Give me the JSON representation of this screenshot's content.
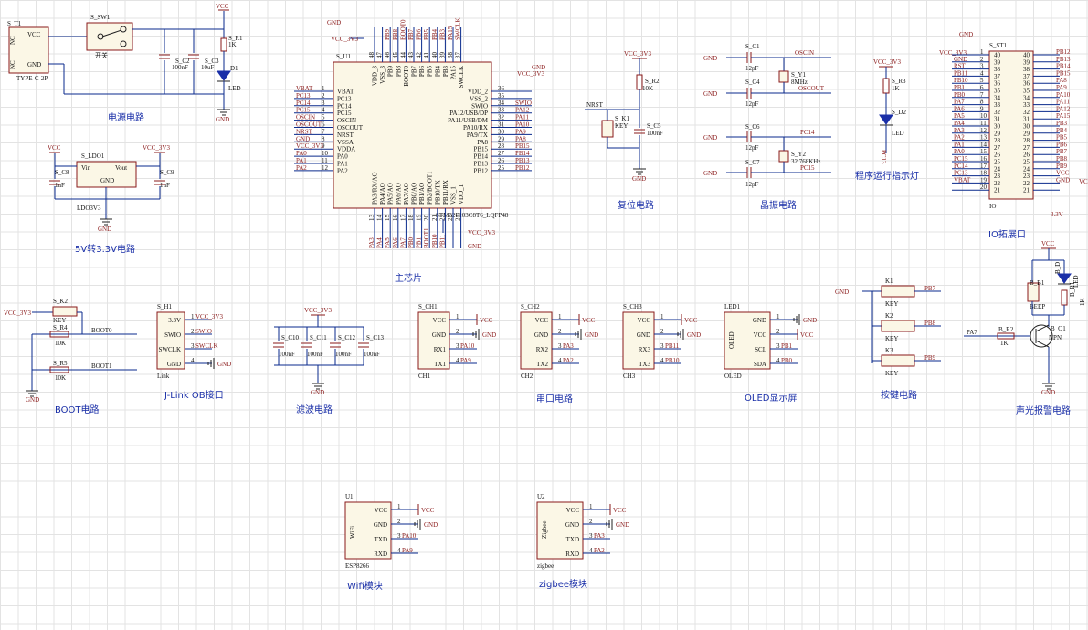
{
  "colors": {
    "wire": "#0a2a8c",
    "component": "#8a1a1a",
    "title": "#1a2fa8",
    "grid": "#e3e3e3"
  },
  "titles": {
    "power": "电源电路",
    "ldo": "5V转3.3V电路",
    "mcu": "主芯片",
    "reset": "复位电路",
    "crystal": "晶振电路",
    "led": "程序运行指示灯",
    "io": "IO拓展口",
    "boot": "BOOT电路",
    "jlink": "J-Link OB接口",
    "filter": "滤波电路",
    "uart": "串口电路",
    "oled": "OLED显示屏",
    "keys": "按键电路",
    "alarm": "声光报警电路",
    "wifi": "Wifi模块",
    "zigbee": "zigbee模块"
  },
  "power": {
    "ref": "S_T1",
    "part": "TYPE-C-2P",
    "pin_vcc": "VCC",
    "pin_gnd": "GND",
    "nc": "NC",
    "sw_ref": "S_SW1",
    "sw_name": "开关",
    "c2": "S_C2",
    "c2v": "100nF",
    "c3": "S_C3",
    "c3v": "10uF",
    "r1": "S_R1",
    "r1v": "1K",
    "d1": "D1",
    "d1v": "LED",
    "vcc": "VCC",
    "gnd": "GND"
  },
  "ldo": {
    "ref": "S_LDO1",
    "part": "LDO3V3",
    "vin": "Vin",
    "vout": "Vout",
    "gnd": "GND",
    "c8": "S_C8",
    "c8v": "1uF",
    "c9": "S_C9",
    "c9v": "1uF",
    "vcc": "VCC",
    "v33": "VCC_3V3"
  },
  "mcu": {
    "ref": "S_U1",
    "part": "STM32F103C8T6_LQFP48",
    "left": [
      [
        "VBAT",
        "1"
      ],
      [
        "PC13",
        "2"
      ],
      [
        "PC14",
        "3"
      ],
      [
        "PC15",
        "4"
      ],
      [
        "OSCIN",
        "5"
      ],
      [
        "OSCOUT",
        "6"
      ],
      [
        "NRST",
        "7"
      ],
      [
        "VSSA",
        "8"
      ],
      [
        "VDDA",
        "9"
      ],
      [
        "PA0",
        "10"
      ],
      [
        "PA1",
        "11"
      ],
      [
        "PA2",
        "12"
      ]
    ],
    "right": [
      [
        "VDD_2",
        "36"
      ],
      [
        "VSS_2",
        "35"
      ],
      [
        "SWIO",
        "34"
      ],
      [
        "PA12/USB/DP",
        "33"
      ],
      [
        "PA11/USB/DM",
        "32"
      ],
      [
        "PA10/RX",
        "31"
      ],
      [
        "PA9/TX",
        "30"
      ],
      [
        "PA8",
        "29"
      ],
      [
        "PB15",
        "28"
      ],
      [
        "PB14",
        "27"
      ],
      [
        "PB13",
        "26"
      ],
      [
        "PB12",
        "25"
      ]
    ],
    "right_nets": [
      "",
      "",
      "SWIO",
      "PA12",
      "PA11",
      "PA10",
      "PA9",
      "PA8",
      "PB15",
      "PB14",
      "PB13",
      "PB12"
    ],
    "left_nets": [
      "VBAT",
      "PC13",
      "PC14",
      "PC15",
      "OSCIN",
      "OSCOUT",
      "NRST",
      "GND",
      "VCC_3V3",
      "PA0",
      "PA1",
      "PA2"
    ],
    "top": [
      "VDD_3",
      "VSS_3",
      "PB9",
      "PB8",
      "BOOT0",
      "PB7",
      "PB6",
      "PB5",
      "PB4",
      "PB3",
      "PA15",
      "SWCLK"
    ],
    "top_nums": [
      "48",
      "47",
      "46",
      "45",
      "44",
      "43",
      "42",
      "41",
      "40",
      "39",
      "38",
      "37"
    ],
    "top_nets": [
      "",
      "",
      "PB9",
      "PB8",
      "BOOT0",
      "PB7",
      "PB6",
      "PB5",
      "PB4",
      "PB3",
      "PA15",
      "SWCLK"
    ],
    "bottom": [
      "PA3/RX/AO",
      "PA4/AO",
      "PA5/AO",
      "PA6/AO",
      "PA7/AO",
      "PB0/AO",
      "PB1/AO",
      "PB2/BOOT1",
      "PB10/TX",
      "PB11/RX",
      "VSS_1",
      "VDD_1"
    ],
    "bottom_nums": [
      "13",
      "14",
      "15",
      "16",
      "17",
      "18",
      "19",
      "20",
      "21",
      "22",
      "23",
      "24"
    ],
    "bottom_nets": [
      "PA3",
      "PA4",
      "PA5",
      "PA6",
      "PA7",
      "PB0",
      "PB1",
      "BOOT1",
      "PB10",
      "PB11",
      "",
      ""
    ],
    "gnd": "GND",
    "v33": "VCC_3V3"
  },
  "reset": {
    "net": "VCC_3V3",
    "r2": "S_R2",
    "r2v": "10K",
    "k1": "S_K1",
    "k1v": "KEY",
    "c5": "S_C5",
    "c5v": "100nF",
    "nrst": "NRST",
    "gnd": "GND"
  },
  "crystal": {
    "c1": "S_C1",
    "c4": "S_C4",
    "c6": "S_C6",
    "c7": "S_C7",
    "cv": "12pF",
    "y1": "S_Y1",
    "y1v": "8MHz",
    "y2": "S_Y2",
    "y2v": "32.768KHz",
    "oscin": "OSCIN",
    "oscout": "OSCOUT",
    "pc14": "PC14",
    "pc15": "PC15",
    "gnd": "GND"
  },
  "led": {
    "net": "VCC_3V3",
    "r3": "S_R3",
    "r3v": "1K",
    "d2": "S_D2",
    "d2v": "LED",
    "pc13": "PC13"
  },
  "io": {
    "ref": "S_ST1",
    "part": "IO",
    "v33": "VCC_3V3",
    "gnd": "GND",
    "vcc": "VCC",
    "v33b": "3.3V",
    "left": [
      "GND",
      "RST",
      "PB11",
      "PB10",
      "PB1",
      "PB0",
      "PA7",
      "PA6",
      "PA5",
      "PA4",
      "PA3",
      "PA2",
      "PA1",
      "PA0",
      "PC15",
      "PC14",
      "PC13",
      "VBAT"
    ],
    "right": [
      "PB12",
      "PB13",
      "PB14",
      "PB15",
      "PA8",
      "PA9",
      "PA10",
      "PA11",
      "PA12",
      "PA15",
      "PB3",
      "PB4",
      "PB5",
      "PB6",
      "PB7",
      "PB8",
      "PB9",
      "VCC",
      "GND"
    ]
  },
  "boot": {
    "net": "VCC_3V3",
    "k2": "S_K2",
    "k2v": "KEY",
    "r4": "S_R4",
    "r4v": "10K",
    "r5": "S_R5",
    "r5v": "10K",
    "boot0": "BOOT0",
    "boot1": "BOOT1",
    "gnd": "GND"
  },
  "jlink": {
    "ref": "S_H1",
    "part": "Link",
    "pins": [
      "3.3V",
      "SWIO",
      "SWCLK",
      "GND"
    ],
    "nets": [
      "VCC_3V3",
      "SWIO",
      "SWCLK",
      "GND"
    ]
  },
  "filter": {
    "net": "VCC_3V3",
    "caps": [
      "S_C10",
      "S_C11",
      "S_C12",
      "S_C13"
    ],
    "cv": "100nF",
    "gnd": "GND"
  },
  "uart": [
    {
      "ref": "S_CH1",
      "part": "CH1",
      "pins": [
        "VCC",
        "GND",
        "RX1",
        "TX1"
      ],
      "nets": [
        "VCC",
        "GND",
        "PA10",
        "PA9"
      ]
    },
    {
      "ref": "S_CH2",
      "part": "CH2",
      "pins": [
        "VCC",
        "GND",
        "RX2",
        "TX2"
      ],
      "nets": [
        "VCC",
        "GND",
        "PA3",
        "PA2"
      ]
    },
    {
      "ref": "S_CH3",
      "part": "CH3",
      "pins": [
        "VCC",
        "GND",
        "RX3",
        "TX3"
      ],
      "nets": [
        "VCC",
        "GND",
        "PB11",
        "PB10"
      ]
    }
  ],
  "oled": {
    "ref": "LED1",
    "part": "OLED",
    "pins": [
      "GND",
      "VCC",
      "SCL",
      "SDA"
    ],
    "nets": [
      "GND",
      "VCC",
      "PB1",
      "PB0"
    ]
  },
  "keys": {
    "gnd": "GND",
    "items": [
      {
        "ref": "K1",
        "v": "KEY",
        "net": "PB7"
      },
      {
        "ref": "K2",
        "v": "KEY",
        "net": "PB8"
      },
      {
        "ref": "K3",
        "v": "KEY",
        "net": "PB9"
      }
    ]
  },
  "alarm": {
    "vcc": "VCC",
    "b1": "B_B1",
    "b1v": "BEEP",
    "d": "B_D",
    "dv": "LED",
    "r1": "B_R1",
    "r1v": "1K",
    "r2": "B_R2",
    "r2v": "1K",
    "q1": "B_Q1",
    "q1v": "NPN",
    "pa7": "PA7",
    "gnd": "GND"
  },
  "wifi": {
    "ref": "U1",
    "part": "ESP8266",
    "side": "WiFi",
    "pins": [
      "VCC",
      "GND",
      "TXD",
      "RXD"
    ],
    "nets": [
      "VCC",
      "GND",
      "PA10",
      "PA9"
    ]
  },
  "zigbee": {
    "ref": "U2",
    "part": "zigbee",
    "side": "Zigbee",
    "pins": [
      "VCC",
      "GND",
      "TXD",
      "RXD"
    ],
    "nets": [
      "VCC",
      "GND",
      "PA3",
      "PA2"
    ]
  }
}
